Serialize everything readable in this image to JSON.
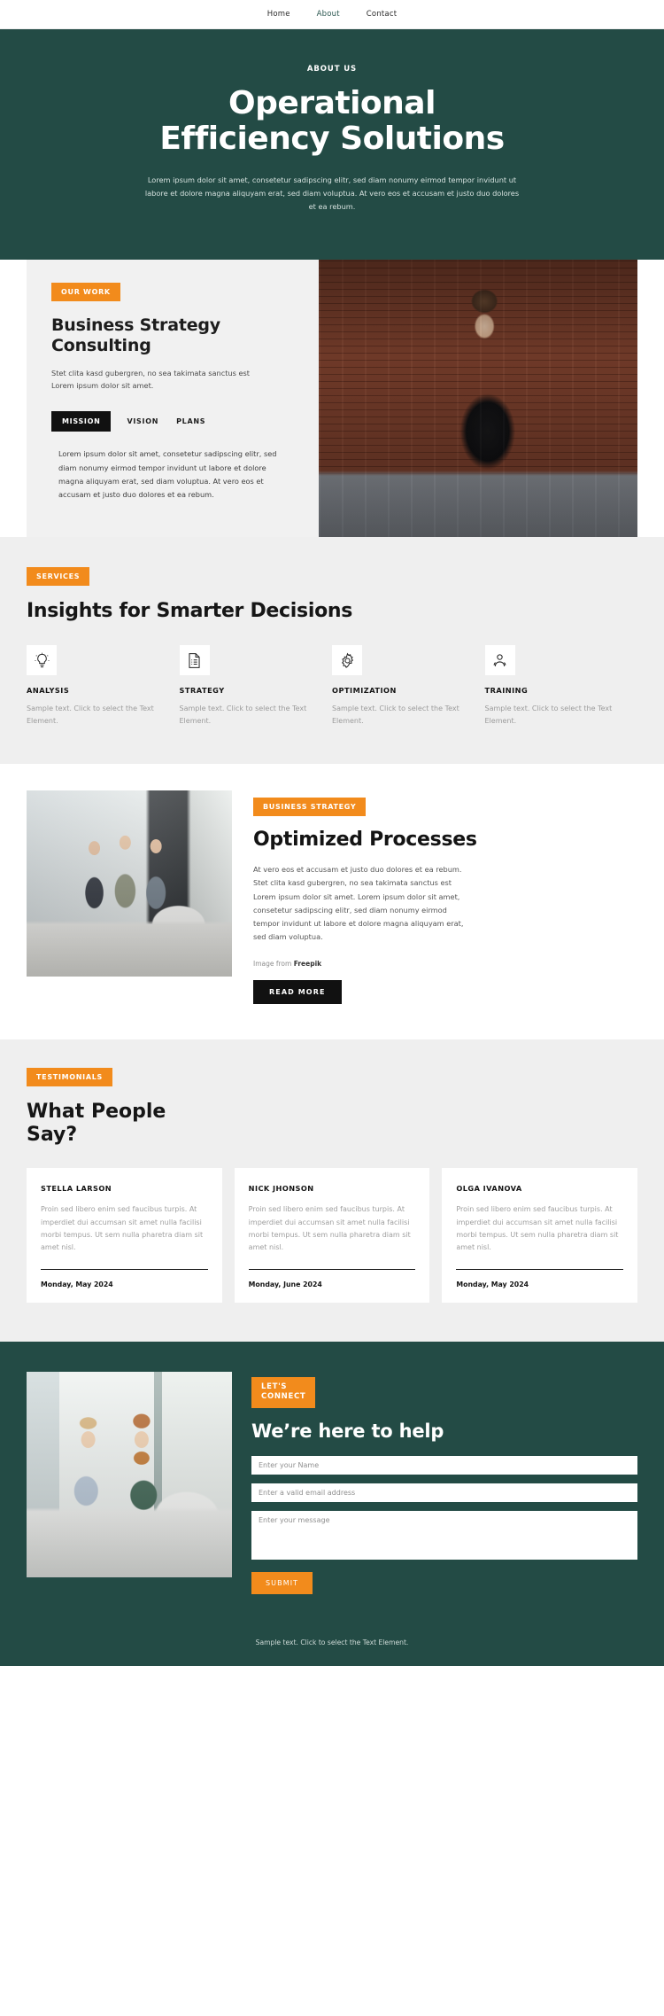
{
  "nav": {
    "items": [
      {
        "label": "Home",
        "active": false
      },
      {
        "label": "About",
        "active": true
      },
      {
        "label": "Contact",
        "active": false
      }
    ]
  },
  "hero": {
    "eyebrow": "ABOUT US",
    "title_line1": "Operational",
    "title_line2": "Efficiency Solutions",
    "paragraph": "Lorem ipsum dolor sit amet, consetetur sadipscing elitr, sed diam nonumy eirmod tempor invidunt ut labore et dolore magna aliquyam erat, sed diam voluptua. At vero eos et accusam et justo duo dolores et ea rebum."
  },
  "work": {
    "badge": "OUR WORK",
    "title": "Business Strategy Consulting",
    "lede": "Stet clita kasd gubergren, no sea takimata sanctus est Lorem ipsum dolor sit amet.",
    "tabs": [
      {
        "label": "MISSION",
        "active": true
      },
      {
        "label": "VISION",
        "active": false
      },
      {
        "label": "PLANS",
        "active": false
      }
    ],
    "body": "Lorem ipsum dolor sit amet, consetetur sadipscing elitr, sed diam nonumy eirmod tempor invidunt ut labore et dolore magna aliquyam erat, sed diam voluptua. At vero eos et accusam et justo duo dolores et ea rebum.",
    "photo_alt": "woman-in-black-turtleneck-portrait"
  },
  "services": {
    "badge": "SERVICES",
    "title": "Insights for Smarter Decisions",
    "items": [
      {
        "icon": "lightbulb-icon",
        "name": "ANALYSIS",
        "desc": "Sample text. Click to select the Text Element."
      },
      {
        "icon": "document-list-icon",
        "name": "STRATEGY",
        "desc": "Sample text. Click to select the Text Element."
      },
      {
        "icon": "gear-icon",
        "name": "OPTIMIZATION",
        "desc": "Sample text. Click to select the Text Element."
      },
      {
        "icon": "person-icon",
        "name": "TRAINING",
        "desc": "Sample text. Click to select the Text Element."
      }
    ]
  },
  "optimized": {
    "badge": "BUSINESS STRATEGY",
    "title": "Optimized Processes",
    "paragraph": "At vero eos et accusam et justo duo dolores et ea rebum. Stet clita kasd gubergren, no sea takimata sanctus est Lorem ipsum dolor sit amet. Lorem ipsum dolor sit amet, consetetur sadipscing elitr, sed diam nonumy eirmod tempor invidunt ut labore et dolore magna aliquyam erat, sed diam voluptua.",
    "credit_prefix": "Image from ",
    "credit_source": "Freepik",
    "button": "READ MORE",
    "photo_alt": "team-meeting-in-office"
  },
  "testimonials": {
    "badge": "TESTIMONIALS",
    "title_line1": "What People",
    "title_line2": "Say?",
    "cards": [
      {
        "name": "STELLA LARSON",
        "text": "Proin sed libero enim sed faucibus turpis. At imperdiet dui accumsan sit amet nulla facilisi morbi tempus. Ut sem nulla pharetra diam sit amet nisl.",
        "date": "Monday, May 2024"
      },
      {
        "name": "NICK JHONSON",
        "text": "Proin sed libero enim sed faucibus turpis. At imperdiet dui accumsan sit amet nulla facilisi morbi tempus. Ut sem nulla pharetra diam sit amet nisl.",
        "date": "Monday, June 2024"
      },
      {
        "name": "OLGA IVANOVA",
        "text": "Proin sed libero enim sed faucibus turpis. At imperdiet dui accumsan sit amet nulla facilisi morbi tempus. Ut sem nulla pharetra diam sit amet nisl.",
        "date": "Monday, May 2024"
      }
    ]
  },
  "contact": {
    "badge_line1": "LET'S",
    "badge_line2": "CONNECT",
    "title": "We’re here to help",
    "name_placeholder": "Enter your Name",
    "email_placeholder": "Enter a valid email address",
    "message_placeholder": "Enter your message",
    "submit": "SUBMIT",
    "photo_alt": "two-colleagues-at-desk-with-computer"
  },
  "footer": {
    "text": "Sample text. Click to select the Text Element."
  },
  "colors": {
    "brand_green": "#234b45",
    "accent_orange": "#f28b1c",
    "dark": "#111111",
    "light_grey": "#efefef"
  }
}
